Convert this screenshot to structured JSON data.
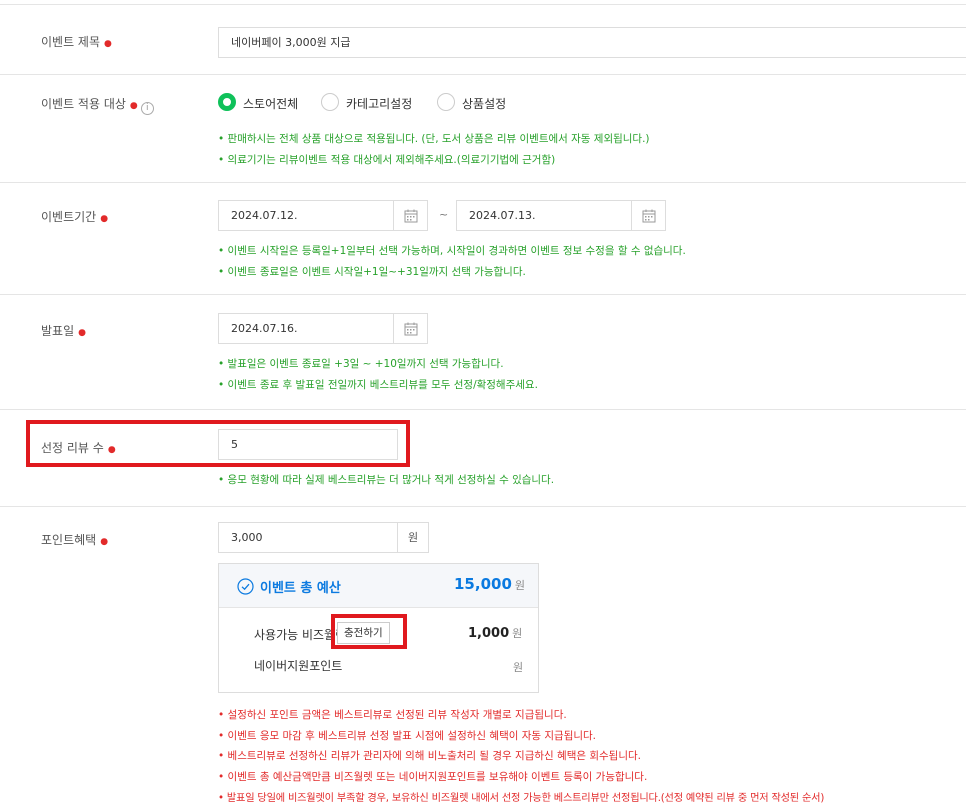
{
  "title": {
    "label": "이벤트 제목",
    "value": "네이버페이 3,000원 지급"
  },
  "target": {
    "label": "이벤트 적용 대상",
    "options": [
      "스토어전체",
      "카테고리설정",
      "상품설정"
    ],
    "selected": "스토어전체",
    "help": [
      "• 판매하시는 전체 상품 대상으로 적용됩니다. (단, 도서 상품은 리뷰 이벤트에서 자동 제외됩니다.)",
      "• 의료기기는 리뷰이벤트 적용 대상에서 제외해주세요.(의료기기법에 근거함)"
    ]
  },
  "period": {
    "label": "이벤트기간",
    "start": "2024.07.12.",
    "separator": "~",
    "end": "2024.07.13.",
    "help": [
      "• 이벤트 시작일은 등록일+1일부터 선택 가능하며, 시작일이 경과하면 이벤트 정보 수정을 할 수 없습니다.",
      "• 이벤트 종료일은 이벤트 시작일+1일~+31일까지 선택 가능합니다."
    ]
  },
  "announce": {
    "label": "발표일",
    "date": "2024.07.16.",
    "help": [
      "• 발표일은 이벤트 종료일 +3일 ~ +10일까지 선택 가능합니다.",
      "• 이벤트 종료 후 발표일 전일까지 베스트리뷰를 모두 선정/확정해주세요."
    ]
  },
  "reviews": {
    "label": "선정 리뷰 수",
    "value": "5",
    "help": [
      "• 응모 현황에 따라 실제 베스트리뷰는 더 많거나 적게 선정하실 수 있습니다."
    ]
  },
  "points": {
    "label": "포인트혜택",
    "value": "3,000",
    "unit": "원",
    "budget": {
      "title": "이벤트 총 예산",
      "total": "15,000",
      "total_unit": "원",
      "bizwallet_label": "사용가능 비즈월렛",
      "charge_button": "충전하기",
      "bizwallet_value": "1,000",
      "bizwallet_unit": "원",
      "naver_points_label": "네이버지원포인트",
      "naver_points_unit": "원"
    },
    "help": [
      "• 설정하신 포인트 금액은 베스트리뷰로 선정된 리뷰 작성자 개별로 지급됩니다.",
      "• 이벤트 응모 마감 후 베스트리뷰 선정 발표 시점에 설정하신 혜택이 자동 지급됩니다.",
      "• 베스트리뷰로 선정하신 리뷰가 관리자에 의해 비노출처리 될 경우 지급하신 혜택은 회수됩니다.",
      "• 이벤트 총 예산금액만큼 비즈월렛 또는 네이버지원포인트를 보유해야 이벤트 등록이 가능합니다.",
      "• 발표일 당일에 비즈월렛이 부족할 경우, 보유하신 비즈월렛 내에서 선정 가능한 베스트리뷰만 선정됩니다.(선정 예약된 리뷰 중 먼저 작성된 순서)"
    ]
  },
  "required_mark": "●",
  "info_icon": "i",
  "colors": {
    "required": "#e22a2a",
    "help_green": "#27a12a",
    "help_red": "#e22a2a",
    "radio_on": "#0fc15a",
    "budget_blue": "#0b7ae0",
    "highlight": "#e0191e"
  },
  "icons": [
    "calendar-icon",
    "check-circle-icon",
    "info-icon"
  ]
}
